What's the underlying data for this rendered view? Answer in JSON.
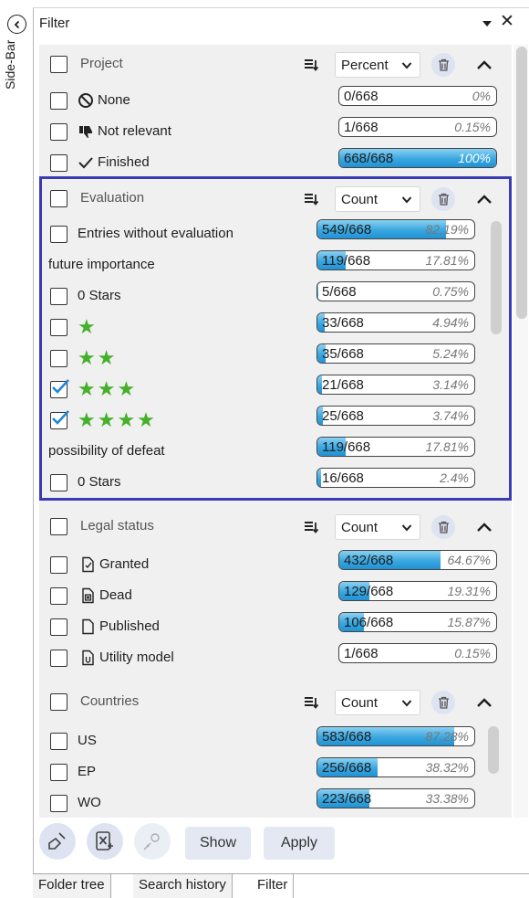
{
  "sidebar": {
    "label": "Side-Bar"
  },
  "panel": {
    "title": "Filter"
  },
  "project": {
    "label": "Project",
    "mode": "Percent",
    "rows": [
      {
        "label": "None",
        "count": "0/668",
        "percent": "0%",
        "fill": 0.0,
        "icon": "no-entry-icon"
      },
      {
        "label": "Not relevant",
        "count": "1/668",
        "percent": "0.15%",
        "fill": 0.0015,
        "icon": "thumbs-down-icon"
      },
      {
        "label": "Finished",
        "count": "668/668",
        "percent": "100%",
        "fill": 1.0,
        "icon": "checkmark-icon"
      }
    ]
  },
  "evaluation": {
    "label": "Evaluation",
    "mode": "Count",
    "rows": [
      {
        "type": "check",
        "label": "Entries without evaluation",
        "checked": false,
        "count": "549/668",
        "percent": "82.19%",
        "fill": 0.8219
      },
      {
        "type": "sub",
        "label": "future importance",
        "count": "119/668",
        "percent": "17.81%",
        "fill": 0.1781
      },
      {
        "type": "check",
        "label": "0 Stars",
        "checked": false,
        "count": "5/668",
        "percent": "0.75%",
        "fill": 0.0075
      },
      {
        "type": "stars",
        "stars": 1,
        "checked": false,
        "count": "33/668",
        "percent": "4.94%",
        "fill": 0.0494
      },
      {
        "type": "stars",
        "stars": 2,
        "checked": false,
        "count": "35/668",
        "percent": "5.24%",
        "fill": 0.0524
      },
      {
        "type": "stars",
        "stars": 3,
        "checked": true,
        "count": "21/668",
        "percent": "3.14%",
        "fill": 0.0314
      },
      {
        "type": "stars",
        "stars": 4,
        "checked": true,
        "count": "25/668",
        "percent": "3.74%",
        "fill": 0.0374
      },
      {
        "type": "sub",
        "label": "possibility of defeat",
        "count": "119/668",
        "percent": "17.81%",
        "fill": 0.1781
      },
      {
        "type": "check",
        "label": "0 Stars",
        "checked": false,
        "count": "16/668",
        "percent": "2.4%",
        "fill": 0.024
      }
    ]
  },
  "legal_status": {
    "label": "Legal status",
    "mode": "Count",
    "rows": [
      {
        "label": "Granted",
        "count": "432/668",
        "percent": "64.67%",
        "fill": 0.6467,
        "icon": "granted-doc-icon"
      },
      {
        "label": "Dead",
        "count": "129/668",
        "percent": "19.31%",
        "fill": 0.1931,
        "icon": "dead-doc-icon"
      },
      {
        "label": "Published",
        "count": "106/668",
        "percent": "15.87%",
        "fill": 0.1587,
        "icon": "published-doc-icon"
      },
      {
        "label": "Utility model",
        "count": "1/668",
        "percent": "0.15%",
        "fill": 0.0015,
        "icon": "utility-model-icon"
      }
    ]
  },
  "countries": {
    "label": "Countries",
    "mode": "Count",
    "rows": [
      {
        "label": "US",
        "count": "583/668",
        "percent": "87.28%",
        "fill": 0.8728
      },
      {
        "label": "EP",
        "count": "256/668",
        "percent": "38.32%",
        "fill": 0.3832
      },
      {
        "label": "WO",
        "count": "223/668",
        "percent": "33.38%",
        "fill": 0.3338
      }
    ]
  },
  "footer": {
    "show_label": "Show",
    "apply_label": "Apply"
  },
  "tabs": [
    "Folder tree",
    "Search history",
    "Filter"
  ],
  "colors": {
    "accent": "#3a3cb6",
    "bar_fill": "#3aa6df",
    "star": "#45b02a"
  }
}
